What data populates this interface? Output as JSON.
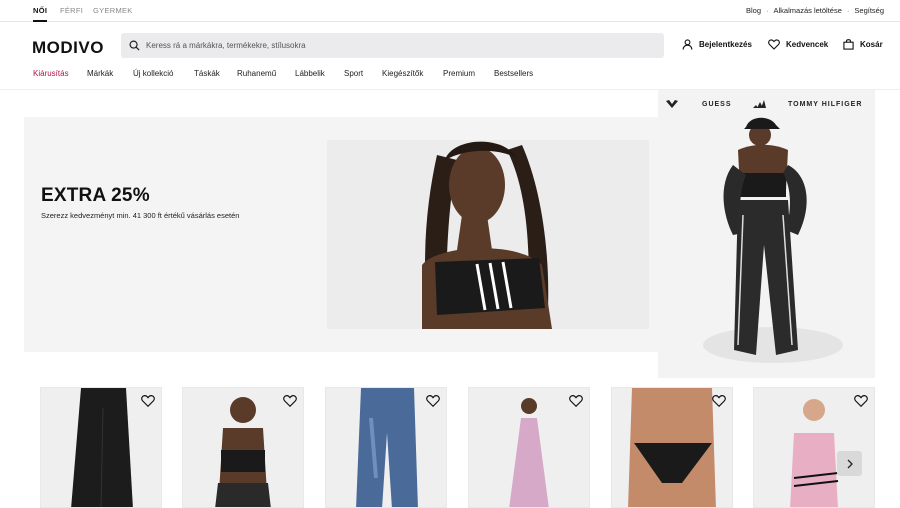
{
  "gender_tabs": [
    "NŐI",
    "FÉRFI",
    "GYERMEK"
  ],
  "utility_links": [
    "Blog",
    "Alkalmazás letöltése",
    "Segítség"
  ],
  "logo": "MODIVO",
  "search": {
    "placeholder": "Keress rá a márkákra, termékekre, stílusokra"
  },
  "header_actions": {
    "login": "Bejelentkezés",
    "favorites": "Kedvencek",
    "cart": "Kosár"
  },
  "categories": [
    "Kiárusítás",
    "Márkák",
    "Új kollekció",
    "Táskák",
    "Ruhanemű",
    "Lábbelik",
    "Sport",
    "Kiegészítők",
    "Premium",
    "Bestsellers"
  ],
  "hero": {
    "title": "EXTRA 25%",
    "subtitle": "Szerezz kedvezményt min. 41 300 ft értékű vásárlás esetén"
  },
  "brands": [
    "GUESS",
    "TOMMY HILFIGER"
  ],
  "products": [
    {
      "name": "black-trousers"
    },
    {
      "name": "black-bandeau-top"
    },
    {
      "name": "blue-jeans"
    },
    {
      "name": "pink-satin-dress"
    },
    {
      "name": "black-bikini-bottom"
    },
    {
      "name": "pink-tank-top"
    }
  ],
  "colors": {
    "sale": "#b3124c",
    "search_bg": "#ebeaec",
    "hero_bg": "#f4f4f4"
  },
  "icons": [
    "search-icon",
    "user-icon",
    "heart-icon",
    "bag-icon",
    "chevron-right-icon"
  ]
}
